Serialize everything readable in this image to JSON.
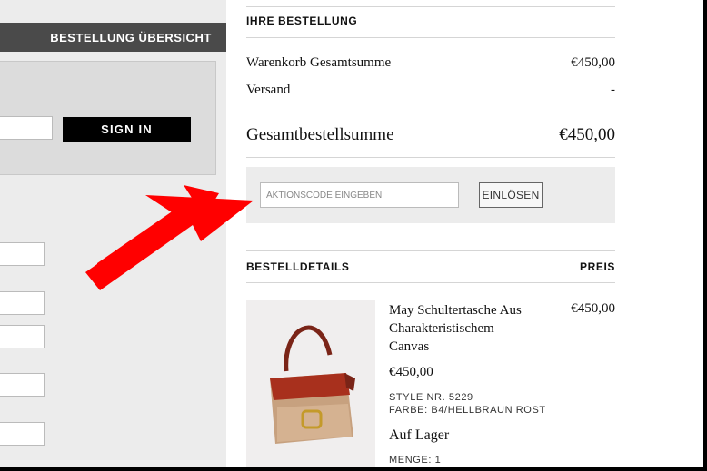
{
  "left": {
    "summary_tab": "BESTELLUNG ÜBERSICHT",
    "signin_label": "SIGN IN"
  },
  "order": {
    "title": "IHRE BESTELLUNG",
    "cart_total_label": "Warenkorb Gesamtsumme",
    "cart_total_value": "€450,00",
    "shipping_label": "Versand",
    "shipping_value": "-",
    "grand_total_label": "Gesamtbestellsumme",
    "grand_total_value": "€450,00"
  },
  "promo": {
    "placeholder": "AKTIONSCODE EINGEBEN",
    "redeem_label": "EINLÖSEN"
  },
  "details": {
    "title": "BESTELLDETAILS",
    "price_header": "PREIS"
  },
  "product": {
    "name_line1": "May Schultertasche Aus",
    "name_line2": "Charakteristischem",
    "name_line3": "Canvas",
    "price_right": "€450,00",
    "price": "€450,00",
    "style": "STYLE NR. 5229",
    "color": "FARBE: B4/HELLBRAUN ROST",
    "stock": "Auf Lager",
    "quantity": "MENGE: 1"
  },
  "annotation": {
    "arrow_color": "#ff0000",
    "arrow_icon": "red-pointer-arrow-icon"
  },
  "product_image_icon": "shoulder-bag-icon"
}
